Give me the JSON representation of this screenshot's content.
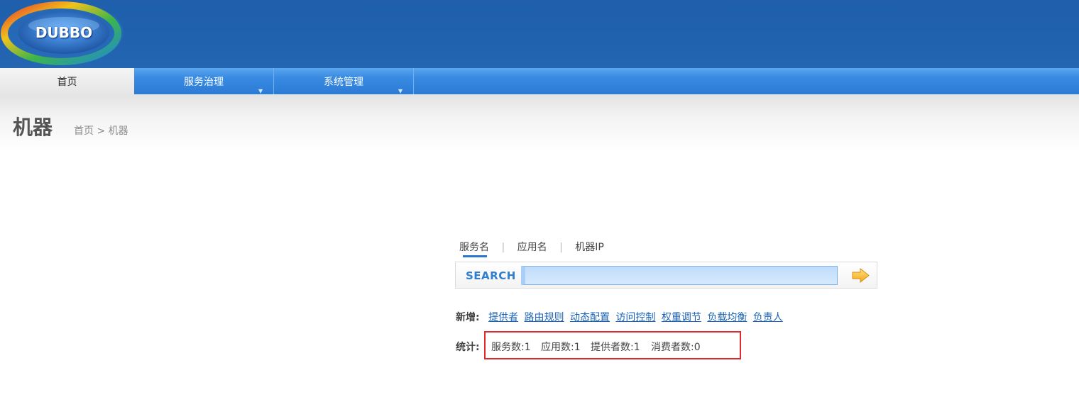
{
  "logo": {
    "text": "DUBBO"
  },
  "nav": {
    "items": [
      {
        "label": "首页",
        "active": true
      },
      {
        "label": "服务治理",
        "has_dropdown": true
      },
      {
        "label": "系统管理",
        "has_dropdown": true
      }
    ]
  },
  "page": {
    "title": "机器",
    "breadcrumb": "首页 > 机器"
  },
  "search": {
    "tabs": [
      "服务名",
      "应用名",
      "机器IP"
    ],
    "separator": "|",
    "label": "SEARCH",
    "value": "",
    "placeholder": ""
  },
  "add": {
    "label": "新增:",
    "links": [
      "提供者",
      "路由规则",
      "动态配置",
      "访问控制",
      "权重调节",
      "负载均衡",
      "负责人"
    ]
  },
  "stats": {
    "label": "统计:",
    "items": [
      "服务数:1",
      "应用数:1",
      "提供者数:1",
      "消费者数:0"
    ]
  },
  "colors": {
    "header_blue": "#2062ae",
    "nav_blue": "#3a8be2",
    "link_blue": "#1c63b7",
    "highlight_red": "#e0292d"
  }
}
